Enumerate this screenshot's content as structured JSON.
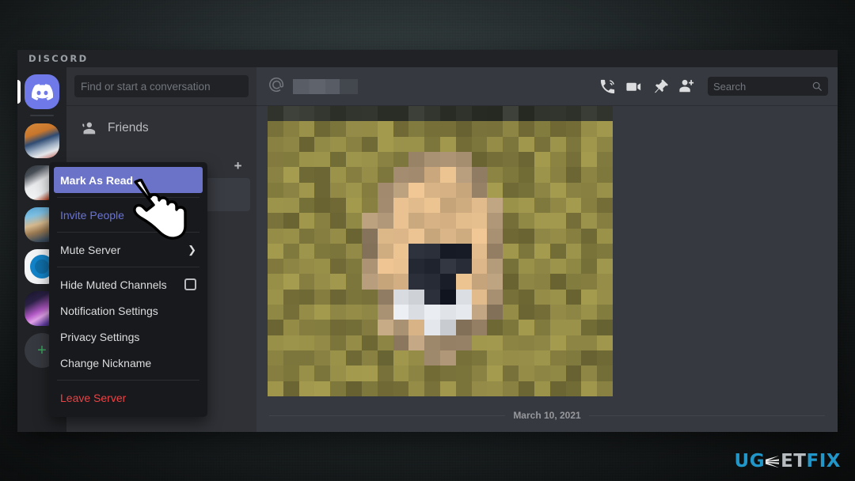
{
  "window": {
    "wordmark": "DISCORD"
  },
  "server_rail": {
    "home_icon": "discord-home-icon",
    "add_server_label": "+",
    "servers": [
      {
        "name": "server-avatar-1"
      },
      {
        "name": "server-avatar-2"
      },
      {
        "name": "server-avatar-3"
      },
      {
        "name": "server-avatar-4"
      },
      {
        "name": "server-avatar-5"
      }
    ]
  },
  "dm_sidebar": {
    "search_placeholder": "Find or start a conversation",
    "friends_label": "Friends",
    "direct_messages_label": "",
    "add_dm_label": "+"
  },
  "chat_header": {
    "at_icon": "at-icon",
    "dm_name": "",
    "icons": [
      {
        "name": "voice-call-icon"
      },
      {
        "name": "video-call-icon"
      },
      {
        "name": "pinned-messages-icon"
      },
      {
        "name": "add-friend-icon"
      }
    ],
    "search_placeholder": "Search",
    "search_icon": "search-icon"
  },
  "chat_body": {
    "date_divider": "March 10, 2021",
    "attachment_alt": "pixelated-photo"
  },
  "context_menu": {
    "items": [
      {
        "label": "Mark As Read",
        "style": "active",
        "accessory": "none"
      },
      {
        "label": "",
        "style": "sep",
        "accessory": "none"
      },
      {
        "label": "Invite People",
        "style": "invite",
        "accessory": "none"
      },
      {
        "label": "",
        "style": "sep",
        "accessory": "none"
      },
      {
        "label": "Mute Server",
        "style": "normal",
        "accessory": "arrow"
      },
      {
        "label": "",
        "style": "sep",
        "accessory": "none"
      },
      {
        "label": "Hide Muted Channels",
        "style": "normal",
        "accessory": "checkbox"
      },
      {
        "label": "Notification Settings",
        "style": "normal",
        "accessory": "none"
      },
      {
        "label": "Privacy Settings",
        "style": "normal",
        "accessory": "none"
      },
      {
        "label": "Change Nickname",
        "style": "normal",
        "accessory": "none"
      },
      {
        "label": "",
        "style": "sep",
        "accessory": "none"
      },
      {
        "label": "Leave Server",
        "style": "danger",
        "accessory": "none"
      }
    ]
  },
  "cursor": {
    "name": "pointing-hand-cursor"
  },
  "watermark": {
    "part1": "UG",
    "part2": "ET",
    "part3": "FIX"
  },
  "colors": {
    "accent_blurple": "#6b73c9",
    "invite_blue": "#6a74d6",
    "danger_red": "#ed4245",
    "menu_bg": "#18191c",
    "sidebar_bg": "#2f3136",
    "chat_bg": "#36393f",
    "rail_bg": "#202225",
    "watermark_blue": "#2196c9"
  }
}
